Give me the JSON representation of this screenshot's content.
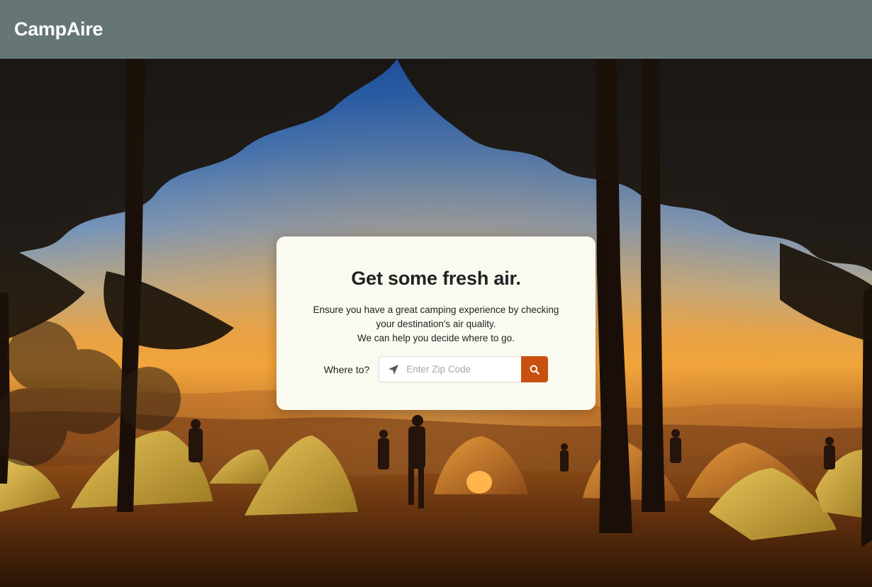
{
  "app": {
    "brand": "CampAire"
  },
  "hero": {
    "heading": "Get some fresh air.",
    "description_line1": "Ensure you have a great camping experience by checking your destination's air quality.",
    "description_line2": "We can help you decide where to go."
  },
  "search": {
    "label": "Where to?",
    "placeholder": "Enter Zip Code",
    "value": "",
    "button_icon": "search-icon",
    "input_icon": "location-arrow-icon"
  },
  "colors": {
    "header": "#667677",
    "card": "#fbfaf1",
    "accent": "#c9500f"
  }
}
